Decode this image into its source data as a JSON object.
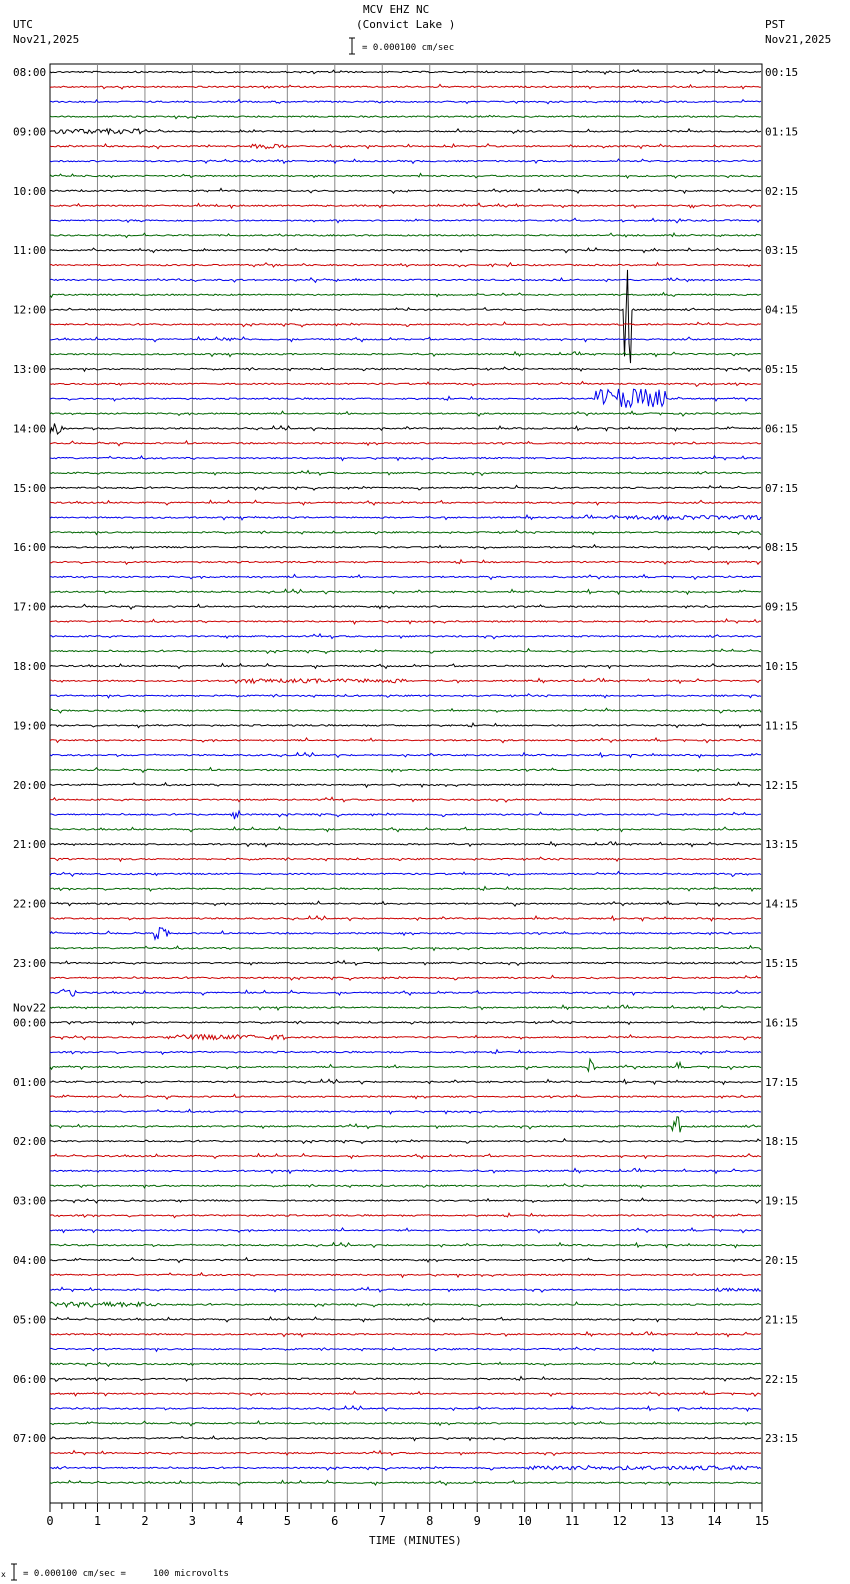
{
  "header": {
    "title": "MCV EHZ NC",
    "subtitle": "(Convict Lake )",
    "scale_label": "= 0.000100 cm/sec",
    "left_tz": "UTC",
    "left_date": "Nov21,2025",
    "right_tz": "PST",
    "right_date": "Nov21,2025"
  },
  "footer": {
    "prefix": "x",
    "scale_text": "= 0.000100 cm/sec =     100 microvolts"
  },
  "chart_data": {
    "type": "line",
    "title": "MCV EHZ NC (Convict Lake )",
    "xlabel": "TIME (MINUTES)",
    "xlim": [
      0,
      15
    ],
    "x_ticks": [
      "0",
      "1",
      "2",
      "3",
      "4",
      "5",
      "6",
      "7",
      "8",
      "9",
      "10",
      "11",
      "12",
      "13",
      "14",
      "15"
    ],
    "trace_count": 96,
    "trace_minutes": 15,
    "trace_colors": [
      "#000000",
      "#cc0000",
      "#0000ee",
      "#006600"
    ],
    "left_labels": [
      "08:00",
      "09:00",
      "10:00",
      "11:00",
      "12:00",
      "13:00",
      "14:00",
      "15:00",
      "16:00",
      "17:00",
      "18:00",
      "19:00",
      "20:00",
      "21:00",
      "22:00",
      "23:00",
      "00:00",
      "01:00",
      "02:00",
      "03:00",
      "04:00",
      "05:00",
      "06:00",
      "07:00"
    ],
    "date_change_label": "Nov22",
    "date_change_index": 16,
    "right_labels": [
      "00:15",
      "01:15",
      "02:15",
      "03:15",
      "04:15",
      "05:15",
      "06:15",
      "07:15",
      "08:15",
      "09:15",
      "10:15",
      "11:15",
      "12:15",
      "13:15",
      "14:15",
      "15:15",
      "16:15",
      "17:15",
      "18:15",
      "19:15",
      "20:15",
      "21:15",
      "22:15",
      "23:15"
    ],
    "events": [
      {
        "trace": 4,
        "start": 0.0,
        "end": 1.9,
        "amp": 2.5
      },
      {
        "trace": 5,
        "start": 4.2,
        "end": 5.0,
        "amp": 2
      },
      {
        "trace": 16,
        "start": 12.1,
        "end": 12.25,
        "amp": 45,
        "up": true
      },
      {
        "trace": 18,
        "start": 3.5,
        "end": 3.9,
        "amp": 2
      },
      {
        "trace": 22,
        "start": 11.5,
        "end": 13.0,
        "amp": 10
      },
      {
        "trace": 24,
        "start": 0.0,
        "end": 0.3,
        "amp": 6
      },
      {
        "trace": 30,
        "start": 11.8,
        "end": 15.0,
        "amp": 2
      },
      {
        "trace": 41,
        "start": 4.0,
        "end": 7.5,
        "amp": 2
      },
      {
        "trace": 50,
        "start": 3.8,
        "end": 4.0,
        "amp": 5
      },
      {
        "trace": 58,
        "start": 2.2,
        "end": 2.5,
        "amp": 6
      },
      {
        "trace": 62,
        "start": 0.2,
        "end": 0.6,
        "amp": 4
      },
      {
        "trace": 65,
        "start": 2.5,
        "end": 5.0,
        "amp": 2.5
      },
      {
        "trace": 67,
        "start": 11.3,
        "end": 11.5,
        "amp": 8
      },
      {
        "trace": 67,
        "start": 13.2,
        "end": 13.3,
        "amp": 5
      },
      {
        "trace": 71,
        "start": 13.1,
        "end": 13.3,
        "amp": 10
      },
      {
        "trace": 82,
        "start": 14.0,
        "end": 15.0,
        "amp": 1.5
      },
      {
        "trace": 83,
        "start": 0.0,
        "end": 2.3,
        "amp": 2.5
      },
      {
        "trace": 94,
        "start": 10.0,
        "end": 15.0,
        "amp": 2
      }
    ]
  }
}
